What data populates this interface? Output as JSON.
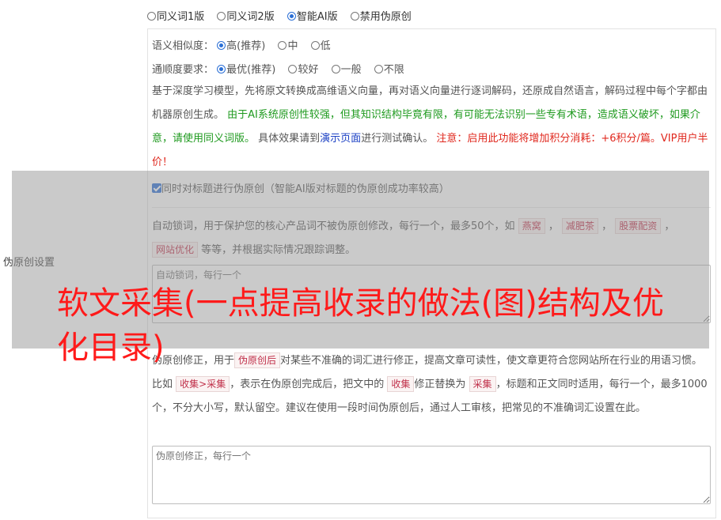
{
  "version_options": [
    {
      "label": "同义词1版",
      "selected": false
    },
    {
      "label": "同义词2版",
      "selected": false
    },
    {
      "label": "智能AI版",
      "selected": true
    },
    {
      "label": "禁用伪原创",
      "selected": false
    }
  ],
  "similarity": {
    "label": "语义相似度：",
    "options": [
      {
        "label": "高(推荐)",
        "selected": true
      },
      {
        "label": "中",
        "selected": false
      },
      {
        "label": "低",
        "selected": false
      }
    ]
  },
  "fluency": {
    "label": "通顺度要求：",
    "options": [
      {
        "label": "最优(推荐)",
        "selected": true
      },
      {
        "label": "较好",
        "selected": false
      },
      {
        "label": "一般",
        "selected": false
      },
      {
        "label": "不限",
        "selected": false
      }
    ]
  },
  "description": {
    "part1": "基于深度学习模型，先将原文转换成高维语义向量，再对语义向量进行逐词解码，还原成自然语言，解码过程中每个字都由机器原创生成。",
    "part2_green": "由于AI系统原创性较强，但其知识结构毕竟有限，有可能无法识别一些专有术语，造成语义破坏，如果介意，请使用同义词版。",
    "part3": "具体效果请到",
    "demo_link": "演示页面",
    "part4": "进行测试确认。",
    "notice_red": "注意：启用此功能将增加积分消耗：+6积分/篇。VIP用户半价！"
  },
  "title_checkbox": {
    "label": "同时对标题进行伪原创（智能AI版对标题的伪原创成功率较高）",
    "checked": true
  },
  "side_label": "伪原创设置",
  "lock_words": {
    "desc1": "自动锁词，用于保护您的核心产品词不被伪原创修改，每行一个，最多50个，如",
    "examples": [
      "燕窝",
      "减肥茶",
      "股票配资",
      "网站优化"
    ],
    "desc2": "等等，并根据实际情况跟踪调整。",
    "placeholder": "自动锁词，每行一个"
  },
  "correction": {
    "desc1": "伪原创修正，用于",
    "chip1": "伪原创后",
    "desc2": "对某些不准确的词汇进行修正，提高文章可读性，使文章更符合您网站所在行业的用语习惯。比如",
    "chip2": "收集>采集",
    "desc3": "，表示在伪原创完成后，把文中的",
    "chip3": "收集",
    "desc4": "修正替换为",
    "chip4": "采集",
    "desc5": "，标题和正文同时适用，每行一个，最多1000个，不分大小写，默认留空。建议在使用一段时间伪原创后，通过人工审核，把常见的不准确词汇设置在此。",
    "placeholder": "伪原创修正，每行一个"
  },
  "headline": "软文采集(一点提高收录的做法(图)结构及优化目录)"
}
